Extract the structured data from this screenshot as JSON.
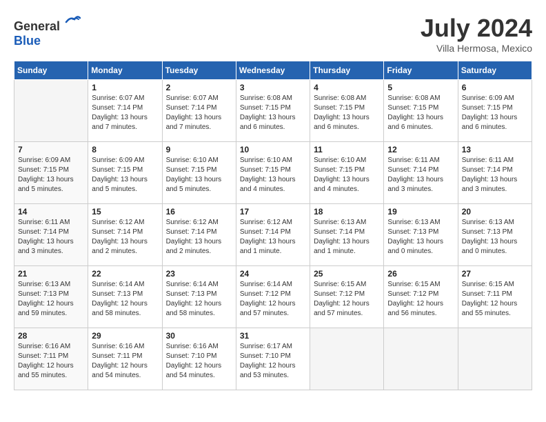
{
  "header": {
    "logo_general": "General",
    "logo_blue": "Blue",
    "month": "July 2024",
    "location": "Villa Hermosa, Mexico"
  },
  "days_of_week": [
    "Sunday",
    "Monday",
    "Tuesday",
    "Wednesday",
    "Thursday",
    "Friday",
    "Saturday"
  ],
  "weeks": [
    [
      {
        "day": "",
        "info": ""
      },
      {
        "day": "1",
        "info": "Sunrise: 6:07 AM\nSunset: 7:14 PM\nDaylight: 13 hours\nand 7 minutes."
      },
      {
        "day": "2",
        "info": "Sunrise: 6:07 AM\nSunset: 7:14 PM\nDaylight: 13 hours\nand 7 minutes."
      },
      {
        "day": "3",
        "info": "Sunrise: 6:08 AM\nSunset: 7:15 PM\nDaylight: 13 hours\nand 6 minutes."
      },
      {
        "day": "4",
        "info": "Sunrise: 6:08 AM\nSunset: 7:15 PM\nDaylight: 13 hours\nand 6 minutes."
      },
      {
        "day": "5",
        "info": "Sunrise: 6:08 AM\nSunset: 7:15 PM\nDaylight: 13 hours\nand 6 minutes."
      },
      {
        "day": "6",
        "info": "Sunrise: 6:09 AM\nSunset: 7:15 PM\nDaylight: 13 hours\nand 6 minutes."
      }
    ],
    [
      {
        "day": "7",
        "info": "Sunrise: 6:09 AM\nSunset: 7:15 PM\nDaylight: 13 hours\nand 5 minutes."
      },
      {
        "day": "8",
        "info": "Sunrise: 6:09 AM\nSunset: 7:15 PM\nDaylight: 13 hours\nand 5 minutes."
      },
      {
        "day": "9",
        "info": "Sunrise: 6:10 AM\nSunset: 7:15 PM\nDaylight: 13 hours\nand 5 minutes."
      },
      {
        "day": "10",
        "info": "Sunrise: 6:10 AM\nSunset: 7:15 PM\nDaylight: 13 hours\nand 4 minutes."
      },
      {
        "day": "11",
        "info": "Sunrise: 6:10 AM\nSunset: 7:15 PM\nDaylight: 13 hours\nand 4 minutes."
      },
      {
        "day": "12",
        "info": "Sunrise: 6:11 AM\nSunset: 7:14 PM\nDaylight: 13 hours\nand 3 minutes."
      },
      {
        "day": "13",
        "info": "Sunrise: 6:11 AM\nSunset: 7:14 PM\nDaylight: 13 hours\nand 3 minutes."
      }
    ],
    [
      {
        "day": "14",
        "info": "Sunrise: 6:11 AM\nSunset: 7:14 PM\nDaylight: 13 hours\nand 3 minutes."
      },
      {
        "day": "15",
        "info": "Sunrise: 6:12 AM\nSunset: 7:14 PM\nDaylight: 13 hours\nand 2 minutes."
      },
      {
        "day": "16",
        "info": "Sunrise: 6:12 AM\nSunset: 7:14 PM\nDaylight: 13 hours\nand 2 minutes."
      },
      {
        "day": "17",
        "info": "Sunrise: 6:12 AM\nSunset: 7:14 PM\nDaylight: 13 hours\nand 1 minute."
      },
      {
        "day": "18",
        "info": "Sunrise: 6:13 AM\nSunset: 7:14 PM\nDaylight: 13 hours\nand 1 minute."
      },
      {
        "day": "19",
        "info": "Sunrise: 6:13 AM\nSunset: 7:13 PM\nDaylight: 13 hours\nand 0 minutes."
      },
      {
        "day": "20",
        "info": "Sunrise: 6:13 AM\nSunset: 7:13 PM\nDaylight: 13 hours\nand 0 minutes."
      }
    ],
    [
      {
        "day": "21",
        "info": "Sunrise: 6:13 AM\nSunset: 7:13 PM\nDaylight: 12 hours\nand 59 minutes."
      },
      {
        "day": "22",
        "info": "Sunrise: 6:14 AM\nSunset: 7:13 PM\nDaylight: 12 hours\nand 58 minutes."
      },
      {
        "day": "23",
        "info": "Sunrise: 6:14 AM\nSunset: 7:13 PM\nDaylight: 12 hours\nand 58 minutes."
      },
      {
        "day": "24",
        "info": "Sunrise: 6:14 AM\nSunset: 7:12 PM\nDaylight: 12 hours\nand 57 minutes."
      },
      {
        "day": "25",
        "info": "Sunrise: 6:15 AM\nSunset: 7:12 PM\nDaylight: 12 hours\nand 57 minutes."
      },
      {
        "day": "26",
        "info": "Sunrise: 6:15 AM\nSunset: 7:12 PM\nDaylight: 12 hours\nand 56 minutes."
      },
      {
        "day": "27",
        "info": "Sunrise: 6:15 AM\nSunset: 7:11 PM\nDaylight: 12 hours\nand 55 minutes."
      }
    ],
    [
      {
        "day": "28",
        "info": "Sunrise: 6:16 AM\nSunset: 7:11 PM\nDaylight: 12 hours\nand 55 minutes."
      },
      {
        "day": "29",
        "info": "Sunrise: 6:16 AM\nSunset: 7:11 PM\nDaylight: 12 hours\nand 54 minutes."
      },
      {
        "day": "30",
        "info": "Sunrise: 6:16 AM\nSunset: 7:10 PM\nDaylight: 12 hours\nand 54 minutes."
      },
      {
        "day": "31",
        "info": "Sunrise: 6:17 AM\nSunset: 7:10 PM\nDaylight: 12 hours\nand 53 minutes."
      },
      {
        "day": "",
        "info": ""
      },
      {
        "day": "",
        "info": ""
      },
      {
        "day": "",
        "info": ""
      }
    ]
  ]
}
